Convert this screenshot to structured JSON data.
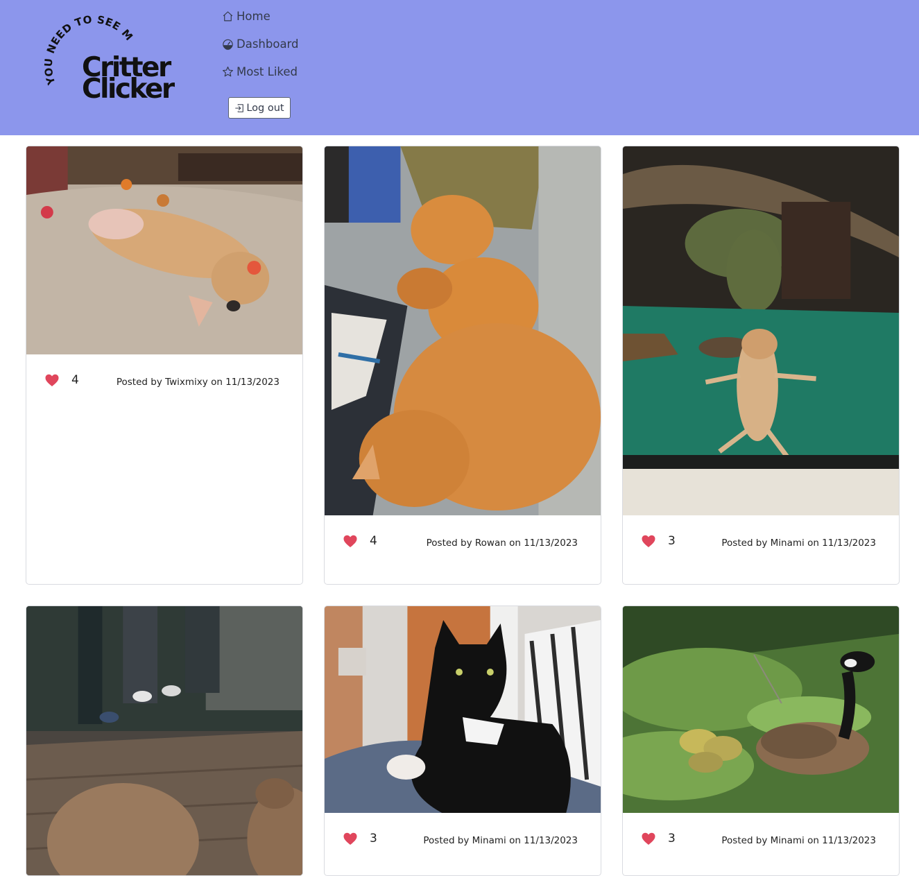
{
  "logo": {
    "arc_text": "YOU NEED TO SEE MY PET",
    "name_line1": "Critter",
    "name_line2": "Clicker"
  },
  "nav": {
    "items": [
      {
        "label": "Home",
        "icon": "house-icon"
      },
      {
        "label": "Dashboard",
        "icon": "speedometer-icon"
      },
      {
        "label": "Most Liked",
        "icon": "star-icon"
      }
    ],
    "logout_label": "Log out"
  },
  "colors": {
    "header_bg": "#8c96ec",
    "heart": "#e0465c",
    "card_border": "#d9dbe0"
  },
  "posts": [
    {
      "image": "dog rolling on carpet",
      "likes": "4",
      "author": "Twixmixy",
      "date": "11/13/2023",
      "posted_text": "Posted by Twixmixy on 11/13/2023"
    },
    {
      "image": "two orange cats sleeping on couch",
      "likes": "4",
      "author": "Rowan",
      "date": "11/13/2023",
      "posted_text": "Posted by Rowan on 11/13/2023"
    },
    {
      "image": "bearded dragon in terrarium",
      "likes": "3",
      "author": "Minami",
      "date": "11/13/2023",
      "posted_text": "Posted by Minami on 11/13/2023"
    },
    {
      "image": "capybaras by glass",
      "likes": "",
      "author": "",
      "date": "",
      "posted_text": ""
    },
    {
      "image": "black and white cat on lap",
      "likes": "3",
      "author": "Minami",
      "date": "11/13/2023",
      "posted_text": "Posted by Minami on 11/13/2023"
    },
    {
      "image": "goose with goslings on grass",
      "likes": "3",
      "author": "Minami",
      "date": "11/13/2023",
      "posted_text": "Posted by Minami on 11/13/2023"
    }
  ]
}
